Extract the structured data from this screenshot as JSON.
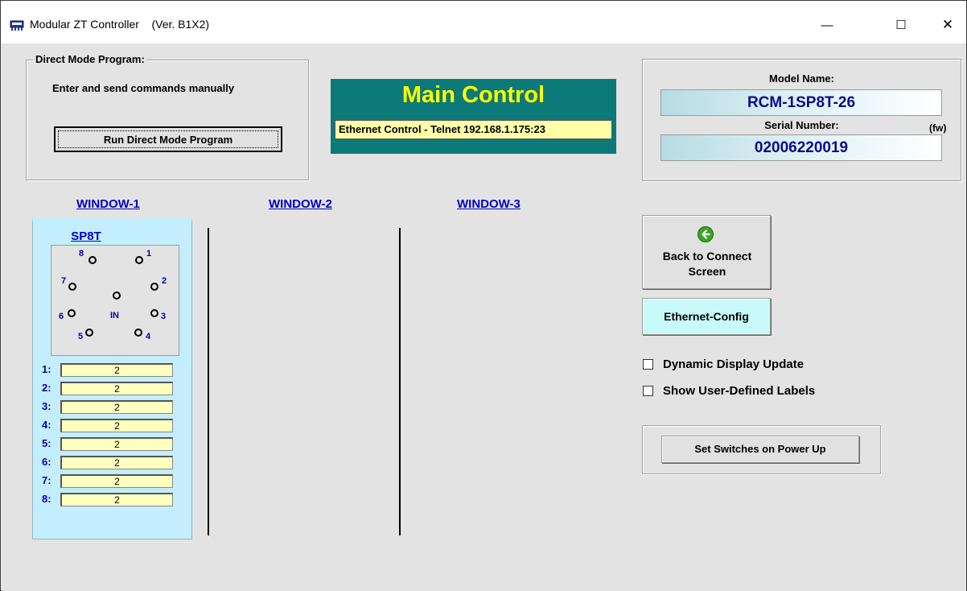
{
  "window": {
    "title": "Modular ZT Controller",
    "version": "(Ver. B1X2)",
    "minimize_glyph": "—",
    "maximize_glyph": "☐",
    "close_glyph": "✕",
    "icon": "controller-icon"
  },
  "direct_mode": {
    "legend": "Direct Mode Program:",
    "description": "Enter and send commands manually",
    "button_label": "Run Direct Mode Program"
  },
  "main_control": {
    "title": "Main Control",
    "status": "Ethernet Control - Telnet 192.168.1.175:23",
    "bg_color": "#0b7a78",
    "title_color": "#ffff00"
  },
  "device_info": {
    "model_label": "Model Name:",
    "model_value": "RCM-1SP8T-26",
    "serial_label": "Serial Number:",
    "fw_label": "(fw)",
    "serial_value": "02006220019"
  },
  "windows": [
    {
      "label": "WINDOW-1"
    },
    {
      "label": "WINDOW-2"
    },
    {
      "label": "WINDOW-3"
    }
  ],
  "switch": {
    "name": "SP8T",
    "in_label": "IN",
    "ports": [
      "1",
      "2",
      "3",
      "4",
      "5",
      "6",
      "7",
      "8"
    ],
    "channels": [
      {
        "label": "1:",
        "value": "2"
      },
      {
        "label": "2:",
        "value": "2"
      },
      {
        "label": "3:",
        "value": "2"
      },
      {
        "label": "4:",
        "value": "2"
      },
      {
        "label": "5:",
        "value": "2"
      },
      {
        "label": "6:",
        "value": "2"
      },
      {
        "label": "7:",
        "value": "2"
      },
      {
        "label": "8:",
        "value": "2"
      }
    ]
  },
  "actions": {
    "back_label_line1": "Back to Connect",
    "back_label_line2": "Screen",
    "back_icon": "back-arrow-icon",
    "ethernet_config_label": "Ethernet-Config",
    "ethernet_btn_color": "#c8fafa"
  },
  "options": {
    "dynamic_display_label": "Dynamic Display Update",
    "dynamic_display_checked": false,
    "user_labels_label": "Show User-Defined Labels",
    "user_labels_checked": false
  },
  "power_up": {
    "button_label": "Set Switches on Power Up"
  }
}
